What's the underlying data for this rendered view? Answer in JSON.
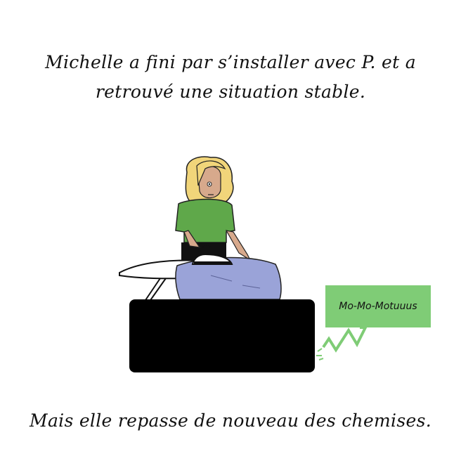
{
  "caption_top": {
    "line1": "Michelle a fini par s’installer avec P. et a",
    "line2": "retrouvé une situation stable."
  },
  "caption_bottom": "Mais elle repasse de nouveau des chemises.",
  "speech_bubble": {
    "text": "Mo-Mo-Motuuus"
  },
  "colors": {
    "hair": "#f1d57a",
    "shirt": "#5fa84a",
    "skin": "#d7a98c",
    "fabric": "#9aa3d8",
    "counter": "#000000",
    "bubble": "#7fcc76"
  }
}
